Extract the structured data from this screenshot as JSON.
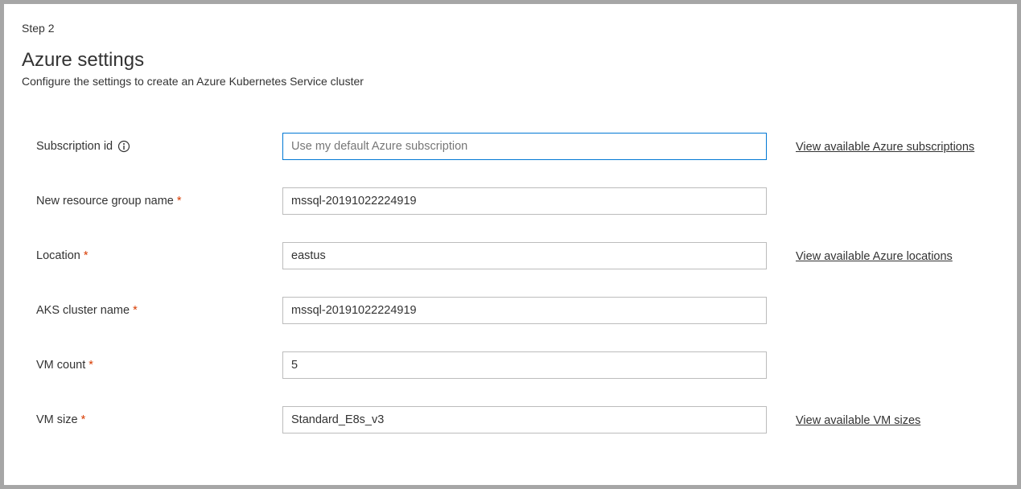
{
  "step_label": "Step 2",
  "title": "Azure settings",
  "subtitle": "Configure the settings to create an Azure Kubernetes Service cluster",
  "fields": {
    "subscription": {
      "label": "Subscription id",
      "placeholder": "Use my default Azure subscription",
      "value": "",
      "link": "View available Azure subscriptions"
    },
    "resource_group": {
      "label": "New resource group name",
      "value": "mssql-20191022224919"
    },
    "location": {
      "label": "Location",
      "value": "eastus",
      "link": "View available Azure locations"
    },
    "aks_cluster": {
      "label": "AKS cluster name",
      "value": "mssql-20191022224919"
    },
    "vm_count": {
      "label": "VM count",
      "value": "5"
    },
    "vm_size": {
      "label": "VM size",
      "value": "Standard_E8s_v3",
      "link": "View available VM sizes"
    }
  }
}
